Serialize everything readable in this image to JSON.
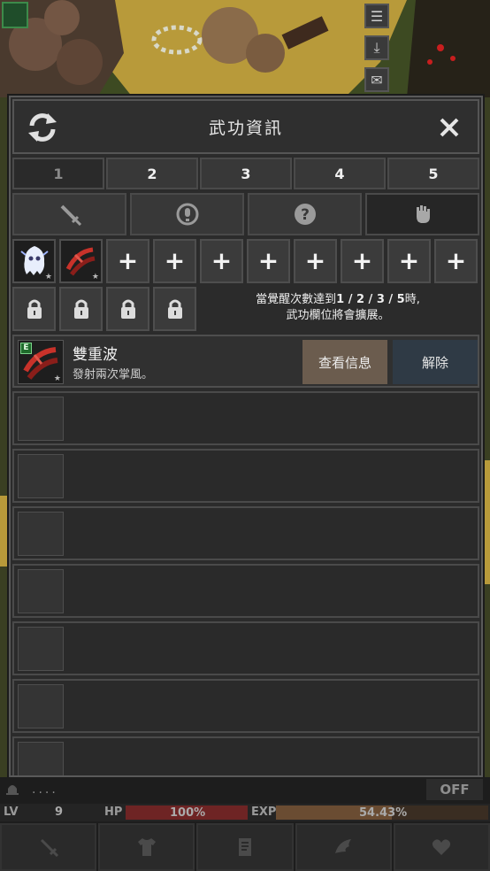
{
  "modal": {
    "title": "武功資訊",
    "refresh_icon": "refresh-icon",
    "close_icon": "close-icon",
    "number_tabs": [
      "1",
      "2",
      "3",
      "4",
      "5"
    ],
    "active_number_tab": "1",
    "type_tabs": [
      "sword-icon",
      "bell-icon",
      "question-icon",
      "fist-icon"
    ],
    "active_type_tab": "fist-icon",
    "equipped_slots": [
      "ghost-skill-icon",
      "double-wave-skill-icon",
      "+",
      "+",
      "+",
      "+",
      "+",
      "+",
      "+",
      "+"
    ],
    "locked_slots": [
      "lock-icon",
      "lock-icon",
      "lock-icon",
      "lock-icon"
    ],
    "lock_note_prefix": "當覺醒次數達到",
    "lock_note_numbers": "1 / 2 / 3 / 5",
    "lock_note_suffix": "時,",
    "lock_note_line2": "武功欄位將會擴展。",
    "selected_skill": {
      "grade": "E",
      "name": "雙重波",
      "desc": "發射兩次掌風。",
      "info_button": "查看信息",
      "remove_button": "解除"
    }
  },
  "hud": {
    "chat": "....",
    "toggle": "OFF",
    "lv_label": "LV",
    "lv_value": "9",
    "hp_label": "HP",
    "hp_value": "100%",
    "exp_label": "EXP",
    "exp_value": "54.43%",
    "exp_fraction": 0.5443,
    "menu_icons": [
      "sword-icon",
      "shirt-icon",
      "scroll-icon",
      "wing-icon",
      "heart-icon"
    ]
  },
  "colors": {
    "info_button": "#6b5c4e",
    "remove_button": "#2f3a45",
    "hp_bar": "#6e2424",
    "exp_bar": "#6a4c32",
    "grade_badge": "#1f6b2c"
  }
}
